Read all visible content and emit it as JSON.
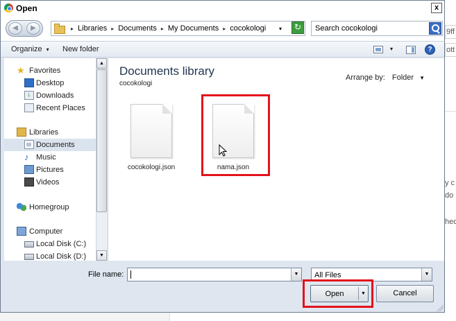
{
  "window": {
    "title": "Open",
    "close_glyph": "x"
  },
  "background": {
    "fragments": [
      "9ff",
      "ott",
      "y c",
      "do",
      "hed"
    ]
  },
  "address_bar": {
    "separator": "▸",
    "crumbs": [
      "Libraries",
      "Documents",
      "My Documents",
      "cocokologi"
    ],
    "dropdown_glyph": "▾",
    "refresh_glyph": "↻"
  },
  "search": {
    "value": "Search cocokologi"
  },
  "toolbar": {
    "organize_label": "Organize",
    "dropdown_glyph": "▾",
    "new_folder_label": "New folder",
    "help_glyph": "?"
  },
  "nav": {
    "items": [
      {
        "label": "Favorites",
        "icon": "star-icon"
      },
      {
        "label": "Desktop",
        "icon": "desktop-icon"
      },
      {
        "label": "Downloads",
        "icon": "downloads-icon"
      },
      {
        "label": "Recent Places",
        "icon": "recent-places-icon"
      },
      {
        "label": "Libraries",
        "icon": "libraries-icon"
      },
      {
        "label": "Documents",
        "icon": "documents-icon",
        "selected": true
      },
      {
        "label": "Music",
        "icon": "music-icon"
      },
      {
        "label": "Pictures",
        "icon": "pictures-icon"
      },
      {
        "label": "Videos",
        "icon": "videos-icon"
      },
      {
        "label": "Homegroup",
        "icon": "homegroup-icon"
      },
      {
        "label": "Computer",
        "icon": "computer-icon"
      },
      {
        "label": "Local Disk (C:)",
        "icon": "disk-icon"
      },
      {
        "label": "Local Disk (D:)",
        "icon": "disk-icon"
      }
    ],
    "scroll_up": "▲",
    "scroll_down": "▼"
  },
  "content": {
    "library_title": "Documents library",
    "library_subtitle": "cocokologi",
    "arrange_label": "Arrange by:",
    "arrange_value": "Folder",
    "arrange_glyph": "▼",
    "files": [
      {
        "name": "cocokologi.json"
      },
      {
        "name": "nama.json"
      }
    ]
  },
  "bottom": {
    "file_name_label": "File name:",
    "file_name_value": "",
    "file_type_value": "All Files",
    "dropdown_glyph": "▼",
    "open_label": "Open",
    "cancel_label": "Cancel"
  },
  "colors": {
    "highlight": "#e3121b",
    "frame": "#dfe6f0",
    "selection": "#dbe4ee"
  }
}
